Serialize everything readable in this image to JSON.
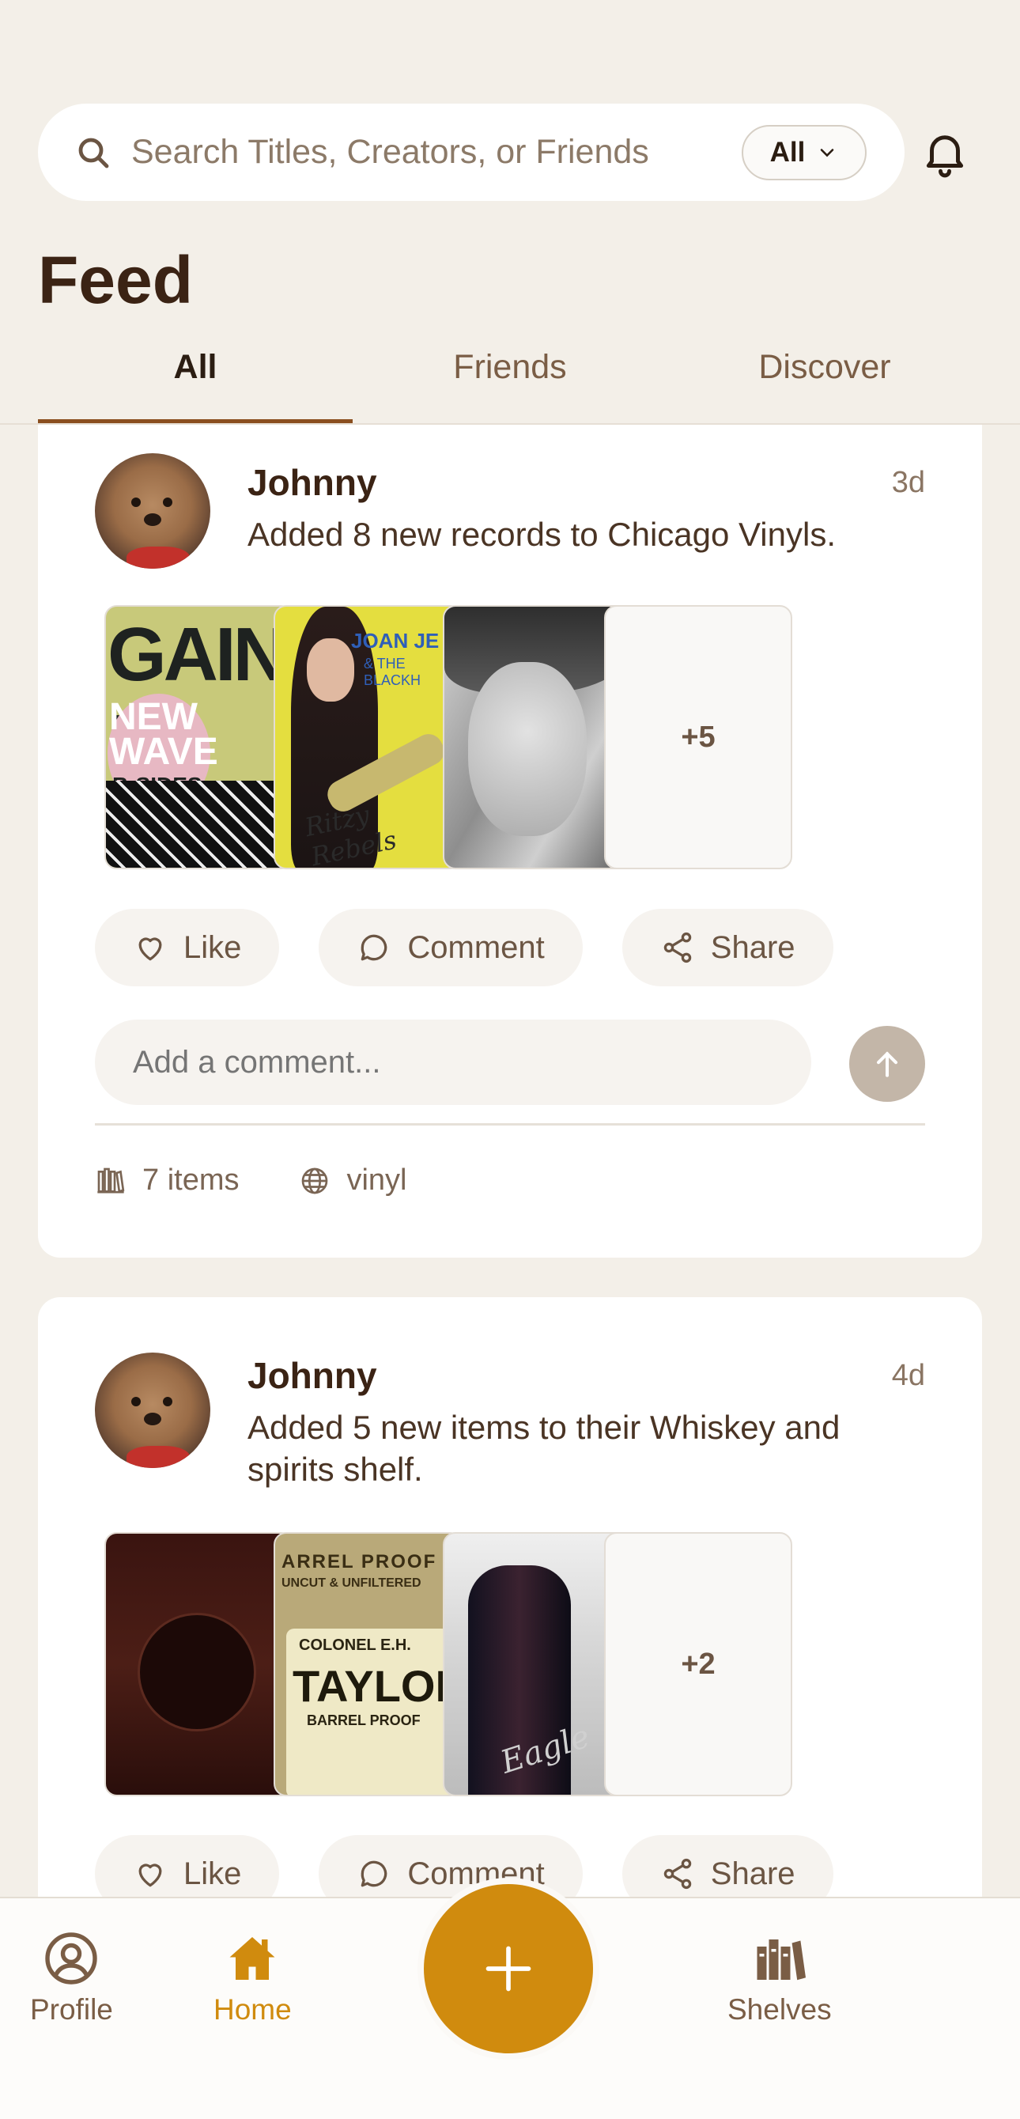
{
  "search": {
    "placeholder": "Search Titles, Creators, or Friends",
    "filter_label": "All"
  },
  "feed": {
    "title": "Feed",
    "tabs": [
      {
        "label": "All",
        "active": true
      },
      {
        "label": "Friends",
        "active": false
      },
      {
        "label": "Discover",
        "active": false
      }
    ]
  },
  "posts": [
    {
      "user": "Johnny",
      "time": "3d",
      "text": "Added 8 new records to Chicago Vinyls.",
      "more_count": "+5",
      "actions": {
        "like": "Like",
        "comment": "Comment",
        "share": "Share"
      },
      "comment_placeholder": "Add a comment...",
      "meta": {
        "items": "7 items",
        "tag": "vinyl"
      }
    },
    {
      "user": "Johnny",
      "time": "4d",
      "text": "Added 5 new items to their Whiskey and spirits shelf.",
      "more_count": "+2",
      "actions": {
        "like": "Like",
        "comment": "Comment",
        "share": "Share"
      }
    }
  ],
  "album_text": {
    "a_big": "GAINS MI",
    "a_nw": "NEW WAVE",
    "a_bs": "B-SIDES",
    "b_title": "JOAN JE",
    "b_sub": "& THE BLACKH",
    "b_script": "Ritzy Rebels",
    "e_top": "ARREL PROOF",
    "e_top2": "UNCUT & UNFILTERED",
    "e_col": "COLONEL E.H.",
    "e_tay": "TAYLOR",
    "e_bp": "BARREL PROOF",
    "f_word": "Eagle"
  },
  "nav": {
    "profile": "Profile",
    "home": "Home",
    "shelves": "Shelves"
  },
  "colors": {
    "accent": "#d08b0e",
    "background": "#f3efe8",
    "text_dark": "#3b2314"
  }
}
